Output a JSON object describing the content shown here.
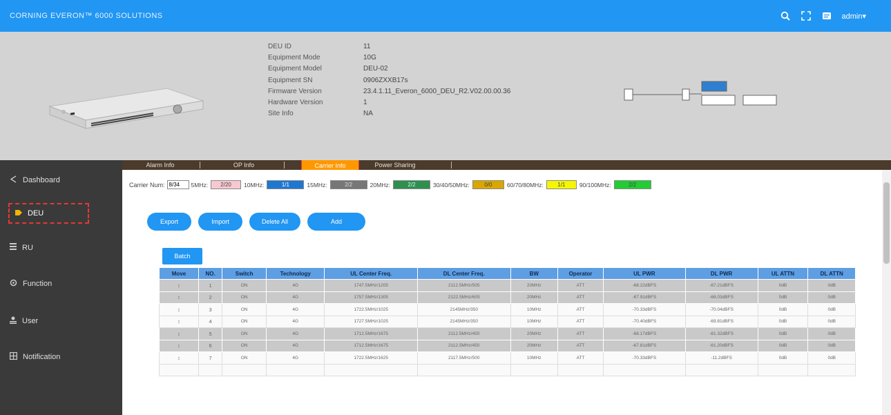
{
  "app": {
    "brand": "CORNING EVERON™ 6000 SOLUTIONS",
    "user": "admin"
  },
  "device": {
    "fields": [
      {
        "label": "DEU ID",
        "value": "11"
      },
      {
        "label": "Equipment Mode",
        "value": "10G"
      },
      {
        "label": "Equipment Model",
        "value": "DEU-02"
      },
      {
        "label": "Equipment SN",
        "value": "0906ZXXB17s"
      },
      {
        "label": "Firmware Version",
        "value": "23.4.1.11_Everon_6000_DEU_R2.V02.00.00.36"
      },
      {
        "label": "Hardware Version",
        "value": "1"
      },
      {
        "label": "Site Info",
        "value": "NA"
      }
    ]
  },
  "sidebar": {
    "items": [
      {
        "label": "Dashboard",
        "icon": "share-icon"
      },
      {
        "label": "DEU",
        "icon": "tag-icon"
      },
      {
        "label": "RU",
        "icon": "grid-icon"
      },
      {
        "label": "Function",
        "icon": "settings-icon"
      },
      {
        "label": "User",
        "icon": "user-icon"
      },
      {
        "label": "Notification",
        "icon": "notification-icon"
      }
    ]
  },
  "tabs": [
    {
      "label": "Alarm Info"
    },
    {
      "label": "OP Info"
    },
    {
      "label": "Carrier Info"
    },
    {
      "label": "Power Sharing"
    }
  ],
  "carrier": {
    "label": "Carrier Num:",
    "value": "8/34",
    "unit": "5MHz:",
    "legend": [
      {
        "label": "10MHz:",
        "color": "#f8c8d0",
        "value": "2/2"
      },
      {
        "label": "15MHz:",
        "color": "#1e78d2",
        "value": "1/1"
      },
      {
        "label": "20MHz:",
        "color": "#777777",
        "value": "2/2"
      },
      {
        "label": "30/40/50MHz:",
        "color": "#2f8f4e",
        "value": "2/2"
      },
      {
        "label": "60/70/80MHz:",
        "color": "#d9a700",
        "value": "0/0"
      },
      {
        "label": "90/100MHz:",
        "color": "#f6f600",
        "value": "1/1"
      },
      {
        "label": "",
        "color": "#22cc33",
        "value": "2/2"
      }
    ],
    "first_swatch": {
      "color": "#f8c8d0",
      "value": "2/20"
    }
  },
  "actions": {
    "export": "Export",
    "import": "Import",
    "delete_all": "Delete All",
    "add": "Add",
    "batch": "Batch"
  },
  "table": {
    "headers": [
      "Move",
      "NO.",
      "Switch",
      "Technology",
      "UL Center Freq.",
      "DL Center Freq.",
      "BW",
      "Operator",
      "UL PWR",
      "DL PWR",
      "UL ATTN",
      "DL ATTN"
    ],
    "rows": [
      {
        "style": "gray",
        "cells": [
          "↕",
          "1",
          "ON",
          "4G",
          "1747.5MHz/1205",
          "2112.5MHz/505",
          "20MHz",
          "ATT",
          "-68.22dBFS",
          "-67.21dBFS",
          "0dB",
          "0dB"
        ]
      },
      {
        "style": "gray",
        "cells": [
          "↕",
          "2",
          "ON",
          "4G",
          "1757.5MHz/1305",
          "2122.5MHz/605",
          "20MHz",
          "ATT",
          "-67.91dBFS",
          "-68.03dBFS",
          "0dB",
          "0dB"
        ]
      },
      {
        "style": "white",
        "cells": [
          "↕",
          "3",
          "ON",
          "4G",
          "1722.5MHz/1025",
          "2145MHz/350",
          "10MHz",
          "ATT",
          "-70.33dBFS",
          "-70.04dBFS",
          "0dB",
          "0dB"
        ]
      },
      {
        "style": "white",
        "cells": [
          "↕",
          "4",
          "ON",
          "4G",
          "1727.5MHz/1025",
          "2145MHz/350",
          "10MHz",
          "ATT",
          "-70.40dBFS",
          "-69.81dBFS",
          "0dB",
          "0dB"
        ]
      },
      {
        "style": "gray",
        "cells": [
          "↕",
          "5",
          "ON",
          "4G",
          "1712.5MHz/1675",
          "2112.5MHz/450",
          "20MHz",
          "ATT",
          "-68.17dBFS",
          "-61.32dBFS",
          "0dB",
          "0dB"
        ]
      },
      {
        "style": "gray",
        "cells": [
          "↕",
          "6",
          "ON",
          "4G",
          "1712.5MHz/1675",
          "2112.5MHz/450",
          "20MHz",
          "ATT",
          "-67.81dBFS",
          "-61.20dBFS",
          "0dB",
          "0dB"
        ]
      },
      {
        "style": "white",
        "cells": [
          "↕",
          "7",
          "ON",
          "4G",
          "1722.5MHz/1625",
          "2117.5MHz/500",
          "10MHz",
          "ATT",
          "-70.33dBFS",
          "-11.2dBFS",
          "0dB",
          "0dB"
        ]
      },
      {
        "style": "white",
        "cells": [
          "",
          "",
          "",
          "",
          "",
          "",
          "",
          "",
          "",
          "",
          "",
          ""
        ]
      }
    ]
  }
}
